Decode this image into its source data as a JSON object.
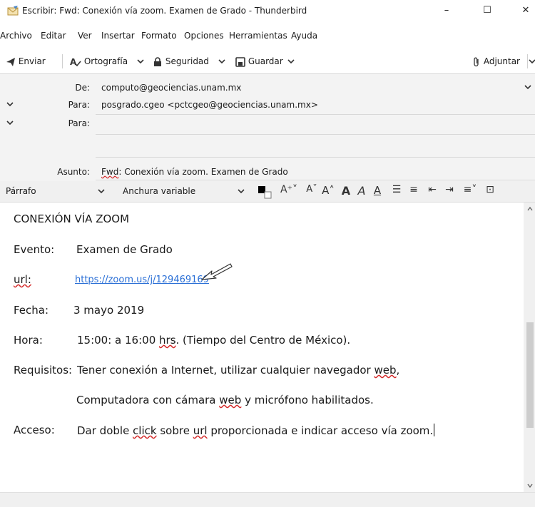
{
  "window": {
    "title": "Escribir: Fwd: Conexión vía zoom. Examen de Grado - Thunderbird",
    "minimize": "–",
    "maximize": "☐",
    "close": "✕"
  },
  "menu": [
    "Archivo",
    "Editar",
    "Ver",
    "Insertar",
    "Formato",
    "Opciones",
    "Herramientas",
    "Ayuda"
  ],
  "toolbar": {
    "send": "Enviar",
    "spelling": "Ortografía",
    "security": "Seguridad",
    "save": "Guardar",
    "attach": "Adjuntar"
  },
  "headers": {
    "from_label": "De:",
    "from_value": "computo@geociencias.unam.mx",
    "to_label": "Para:",
    "to_value": "posgrado.cgeo <pctcgeo@geociencias.unam.mx>",
    "to2_label": "Para:",
    "to2_value": "",
    "subject_label": "Asunto:",
    "subject_value": "Fwd: Conexión vía zoom. Examen de Grado"
  },
  "format": {
    "paragraph": "Párrafo",
    "font": "Anchura variable"
  },
  "message": {
    "heading": "CONEXIÓN VÍA ZOOM",
    "event_label": "Evento:",
    "event_value": "Examen de Grado",
    "url_label": "url:",
    "url_value": "https://zoom.us/j/129469169",
    "date_label": "Fecha:",
    "date_value": "3 mayo 2019",
    "time_label": "Hora:",
    "time_value_a": "15:00: a 16:00 ",
    "time_value_b": "hrs",
    "time_value_c": ". (Tiempo del Centro de México).",
    "req_label": "Requisitos:",
    "req_value_a": "Tener conexión a Internet, utilizar cualquier navegador ",
    "req_value_b": "web",
    "req_value_c": ",",
    "req2_a": "Computadora con cámara ",
    "req2_b": "web",
    "req2_c": " y micrófono habilitados.",
    "access_label": "Acceso:",
    "access_a": "Dar doble ",
    "access_b": "click",
    "access_c": " sobre ",
    "access_d": "url",
    "access_e": " proporcionada e indicar acceso vía zoom."
  },
  "colors": {
    "link": "#2a6fd6",
    "spell_error": "#d42a2a",
    "header_bg": "#f3f3f3",
    "format_bar_bg": "#f0f0f0"
  }
}
